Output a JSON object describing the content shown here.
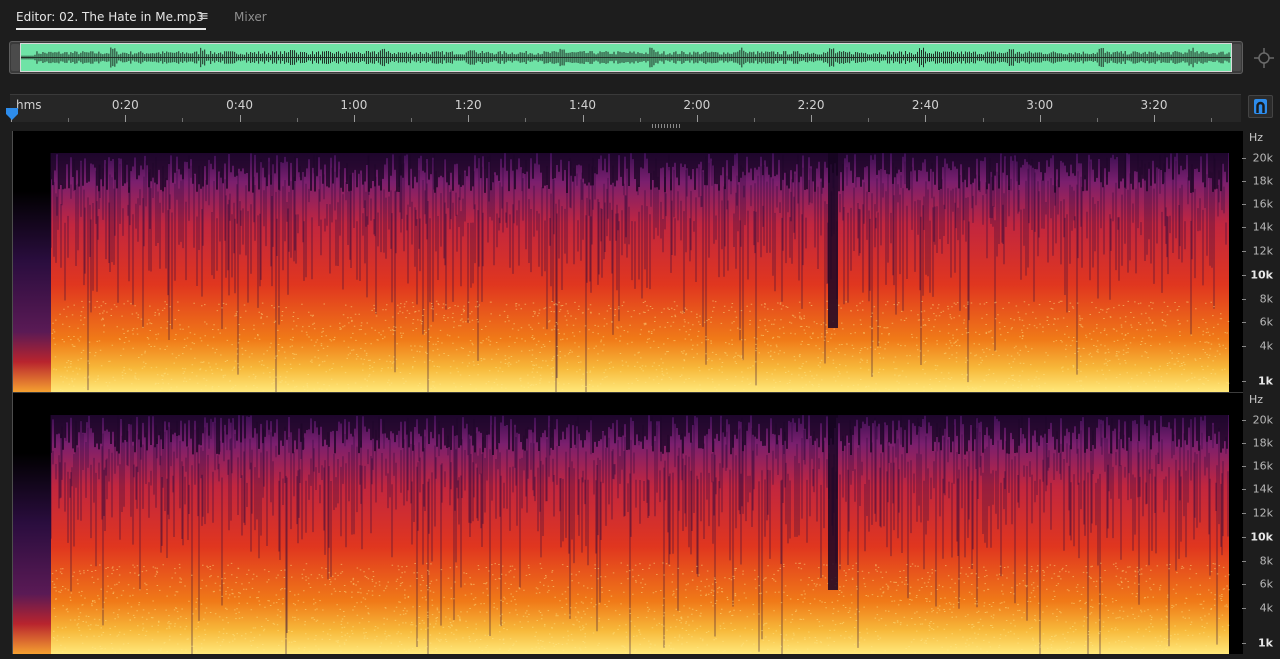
{
  "tabs": {
    "editor_label": "Editor: 02. The Hate in Me.mp3",
    "menu_glyph": "≡",
    "mixer_label": "Mixer"
  },
  "ruler": {
    "unit": "hms",
    "labels": [
      "0:20",
      "0:40",
      "1:00",
      "1:20",
      "1:40",
      "2:00",
      "2:20",
      "2:40",
      "3:00",
      "3:20"
    ]
  },
  "frequency_axis": {
    "unit": "Hz",
    "labels": [
      "20k",
      "18k",
      "16k",
      "14k",
      "12k",
      "10k",
      "8k",
      "6k",
      "4k",
      "1k"
    ]
  },
  "colors": {
    "overview_wave": "#6fe3a6",
    "accent": "#2d8ceb"
  },
  "icons": {
    "menu": "hamburger-menu-icon",
    "zoom": "zoom-crosshair-icon",
    "snap": "magnet-icon",
    "playhead": "playhead-marker-icon"
  }
}
